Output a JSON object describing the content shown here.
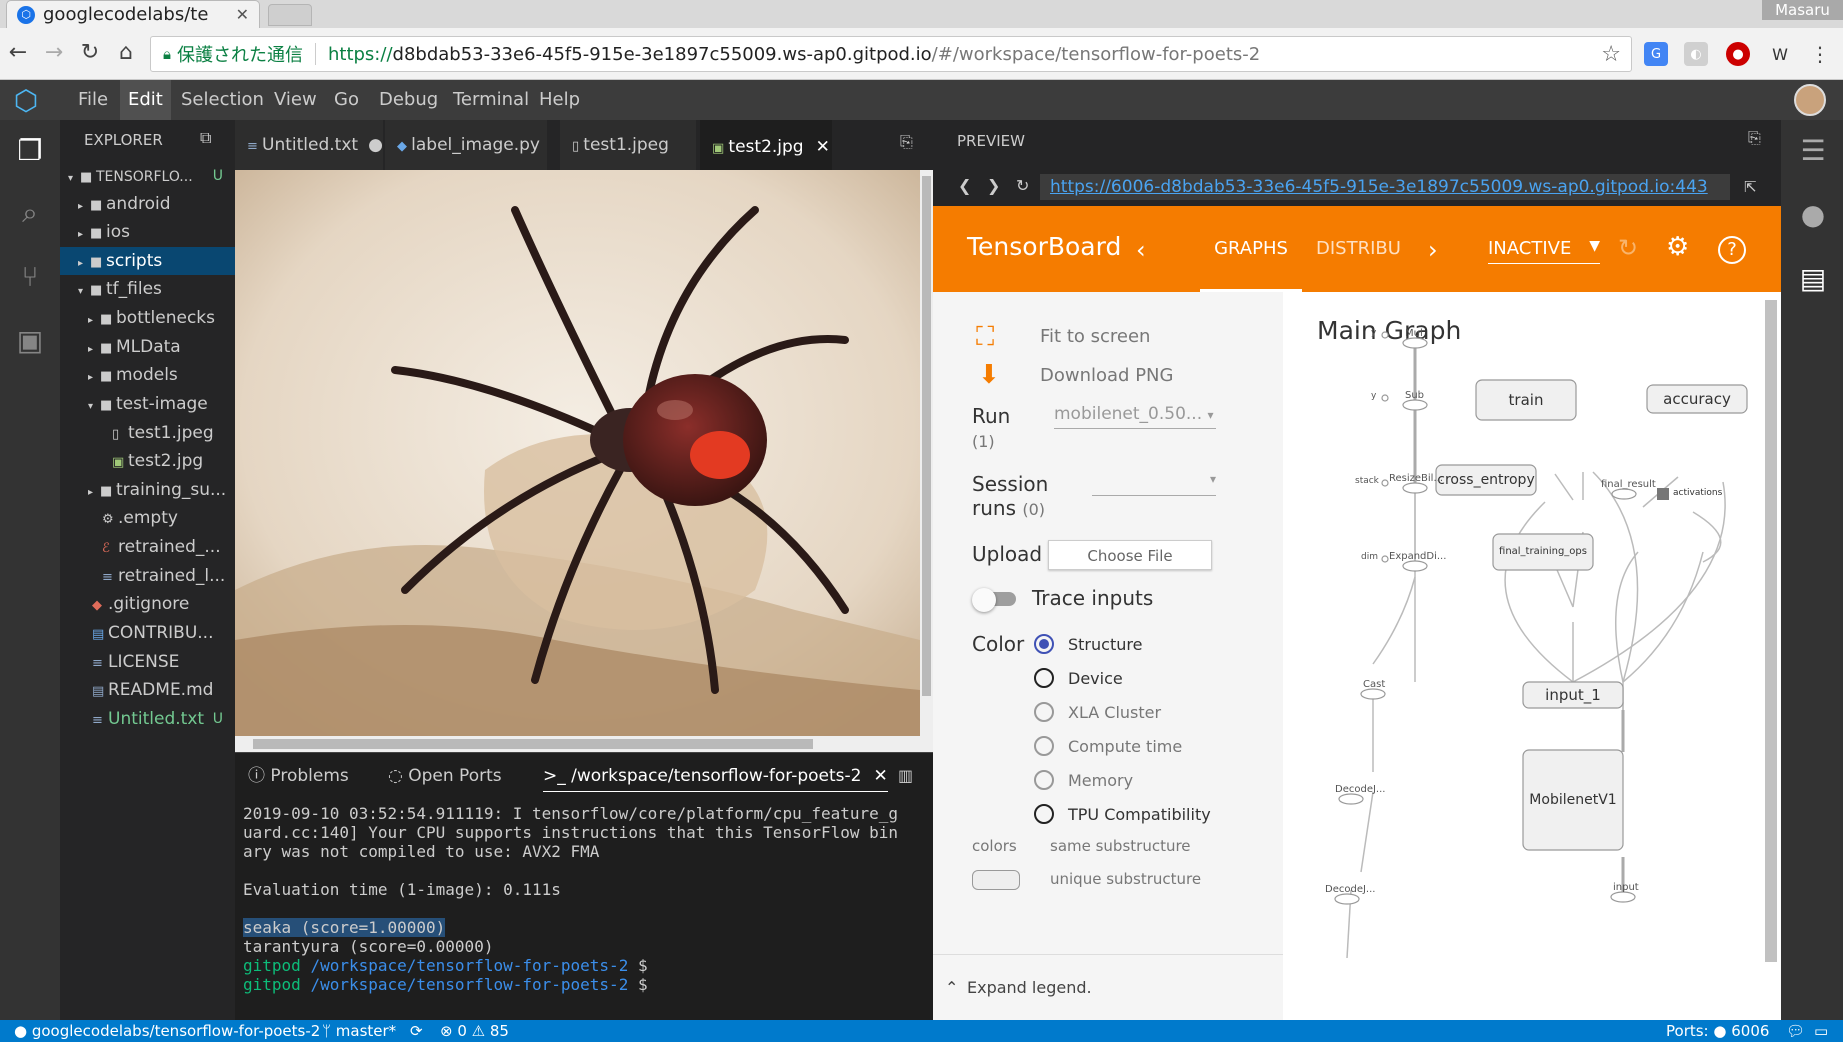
{
  "browser": {
    "tab_title": "googlecodelabs/te",
    "user_name": "Masaru",
    "secure_label": "保護された通信",
    "url_proto": "https://",
    "url_host": "d8bdab53-33e6-45f5-915e-3e1897c55009.ws-ap0.gitpod.io",
    "url_path": "/#/workspace/tensorflow-for-poets-2"
  },
  "menu": [
    "File",
    "Edit",
    "Selection",
    "View",
    "Go",
    "Debug",
    "Terminal",
    "Help"
  ],
  "explorer": {
    "title": "EXPLORER",
    "root": "TENSORFLO...",
    "root_badge": "U",
    "items": [
      {
        "label": "android"
      },
      {
        "label": "ios"
      },
      {
        "label": "scripts"
      },
      {
        "label": "tf_files"
      },
      {
        "label": "bottlenecks"
      },
      {
        "label": "MLData"
      },
      {
        "label": "models"
      },
      {
        "label": "test-image"
      },
      {
        "label": "test1.jpeg"
      },
      {
        "label": "test2.jpg"
      },
      {
        "label": "training_su..."
      },
      {
        "label": ".empty"
      },
      {
        "label": "retrained_..."
      },
      {
        "label": "retrained_l..."
      },
      {
        "label": ".gitignore"
      },
      {
        "label": "CONTRIBU..."
      },
      {
        "label": "LICENSE"
      },
      {
        "label": "README.md"
      },
      {
        "label": "Untitled.txt"
      }
    ],
    "untitled_badge": "U"
  },
  "editor_tabs": [
    {
      "label": "Untitled.txt"
    },
    {
      "label": "label_image.py"
    },
    {
      "label": "test1.jpeg"
    },
    {
      "label": "test2.jpg"
    }
  ],
  "panel": {
    "tabs": [
      "Problems",
      "Open Ports",
      ">_ /workspace/tensorflow-for-poets-2"
    ],
    "term_lines": [
      "2019-09-10 03:52:54.911119: I tensorflow/core/platform/cpu_feature_g",
      "uard.cc:140] Your CPU supports instructions that this TensorFlow bin",
      "ary was not compiled to use: AVX2 FMA",
      "",
      "Evaluation time (1-image): 0.111s",
      ""
    ],
    "result_1": "seaka (score=1.00000)",
    "result_2": "tarantyura (score=0.00000)",
    "prompt_user": "gitpod",
    "prompt_path": "/workspace/tensorflow-for-poets-2",
    "prompt_sym": "$"
  },
  "preview": {
    "title": "PREVIEW",
    "url": "https://6006-d8bdab53-33e6-45f5-915e-3e1897c55009.ws-ap0.gitpod.io:443"
  },
  "tensorboard": {
    "title": "TensorBoard",
    "tab_graphs": "GRAPHS",
    "tab_distrib": "DISTRIBUTIONS",
    "status": "INACTIVE",
    "fit": "Fit to screen",
    "download": "Download PNG",
    "run_label": "Run",
    "run_count": "(1)",
    "run_value": "mobilenet_0.50...",
    "session_label_1": "Session",
    "session_label_2": "runs",
    "session_count": "(0)",
    "upload_label": "Upload",
    "choose_file": "Choose File",
    "trace_label": "Trace inputs",
    "color_label": "Color",
    "color_options": [
      "Structure",
      "Device",
      "XLA Cluster",
      "Compute time",
      "Memory",
      "TPU Compatibility"
    ],
    "colors_label": "colors",
    "same_sub": "same substructure",
    "unique_sub": "unique substructure",
    "expand_legend": "Expand legend.",
    "graph_title": "Main Graph",
    "nodes": {
      "train": "train",
      "accuracy": "accuracy",
      "cross_entropy": "cross_entropy",
      "final_training_ops": "final_training_ops",
      "input_1": "input_1",
      "mobilenet": "MobilenetV1",
      "mul": "Mul",
      "sub": "Sub",
      "resize": "ResizeBil...",
      "expand": "ExpandDi...",
      "cast": "Cast",
      "decode1": "DecodeJ...",
      "decode2": "DecodeJ...",
      "input": "input",
      "final_result": "final_result",
      "activations": "activations",
      "y1": "y",
      "y2": "y",
      "stack": "stack",
      "dim": "dim"
    }
  },
  "status": {
    "repo": "googlecodelabs/tensorflow-for-poets-2",
    "branch": "master*",
    "errors": "0",
    "warnings": "85",
    "ports": "Ports:",
    "port_num": "6006"
  }
}
